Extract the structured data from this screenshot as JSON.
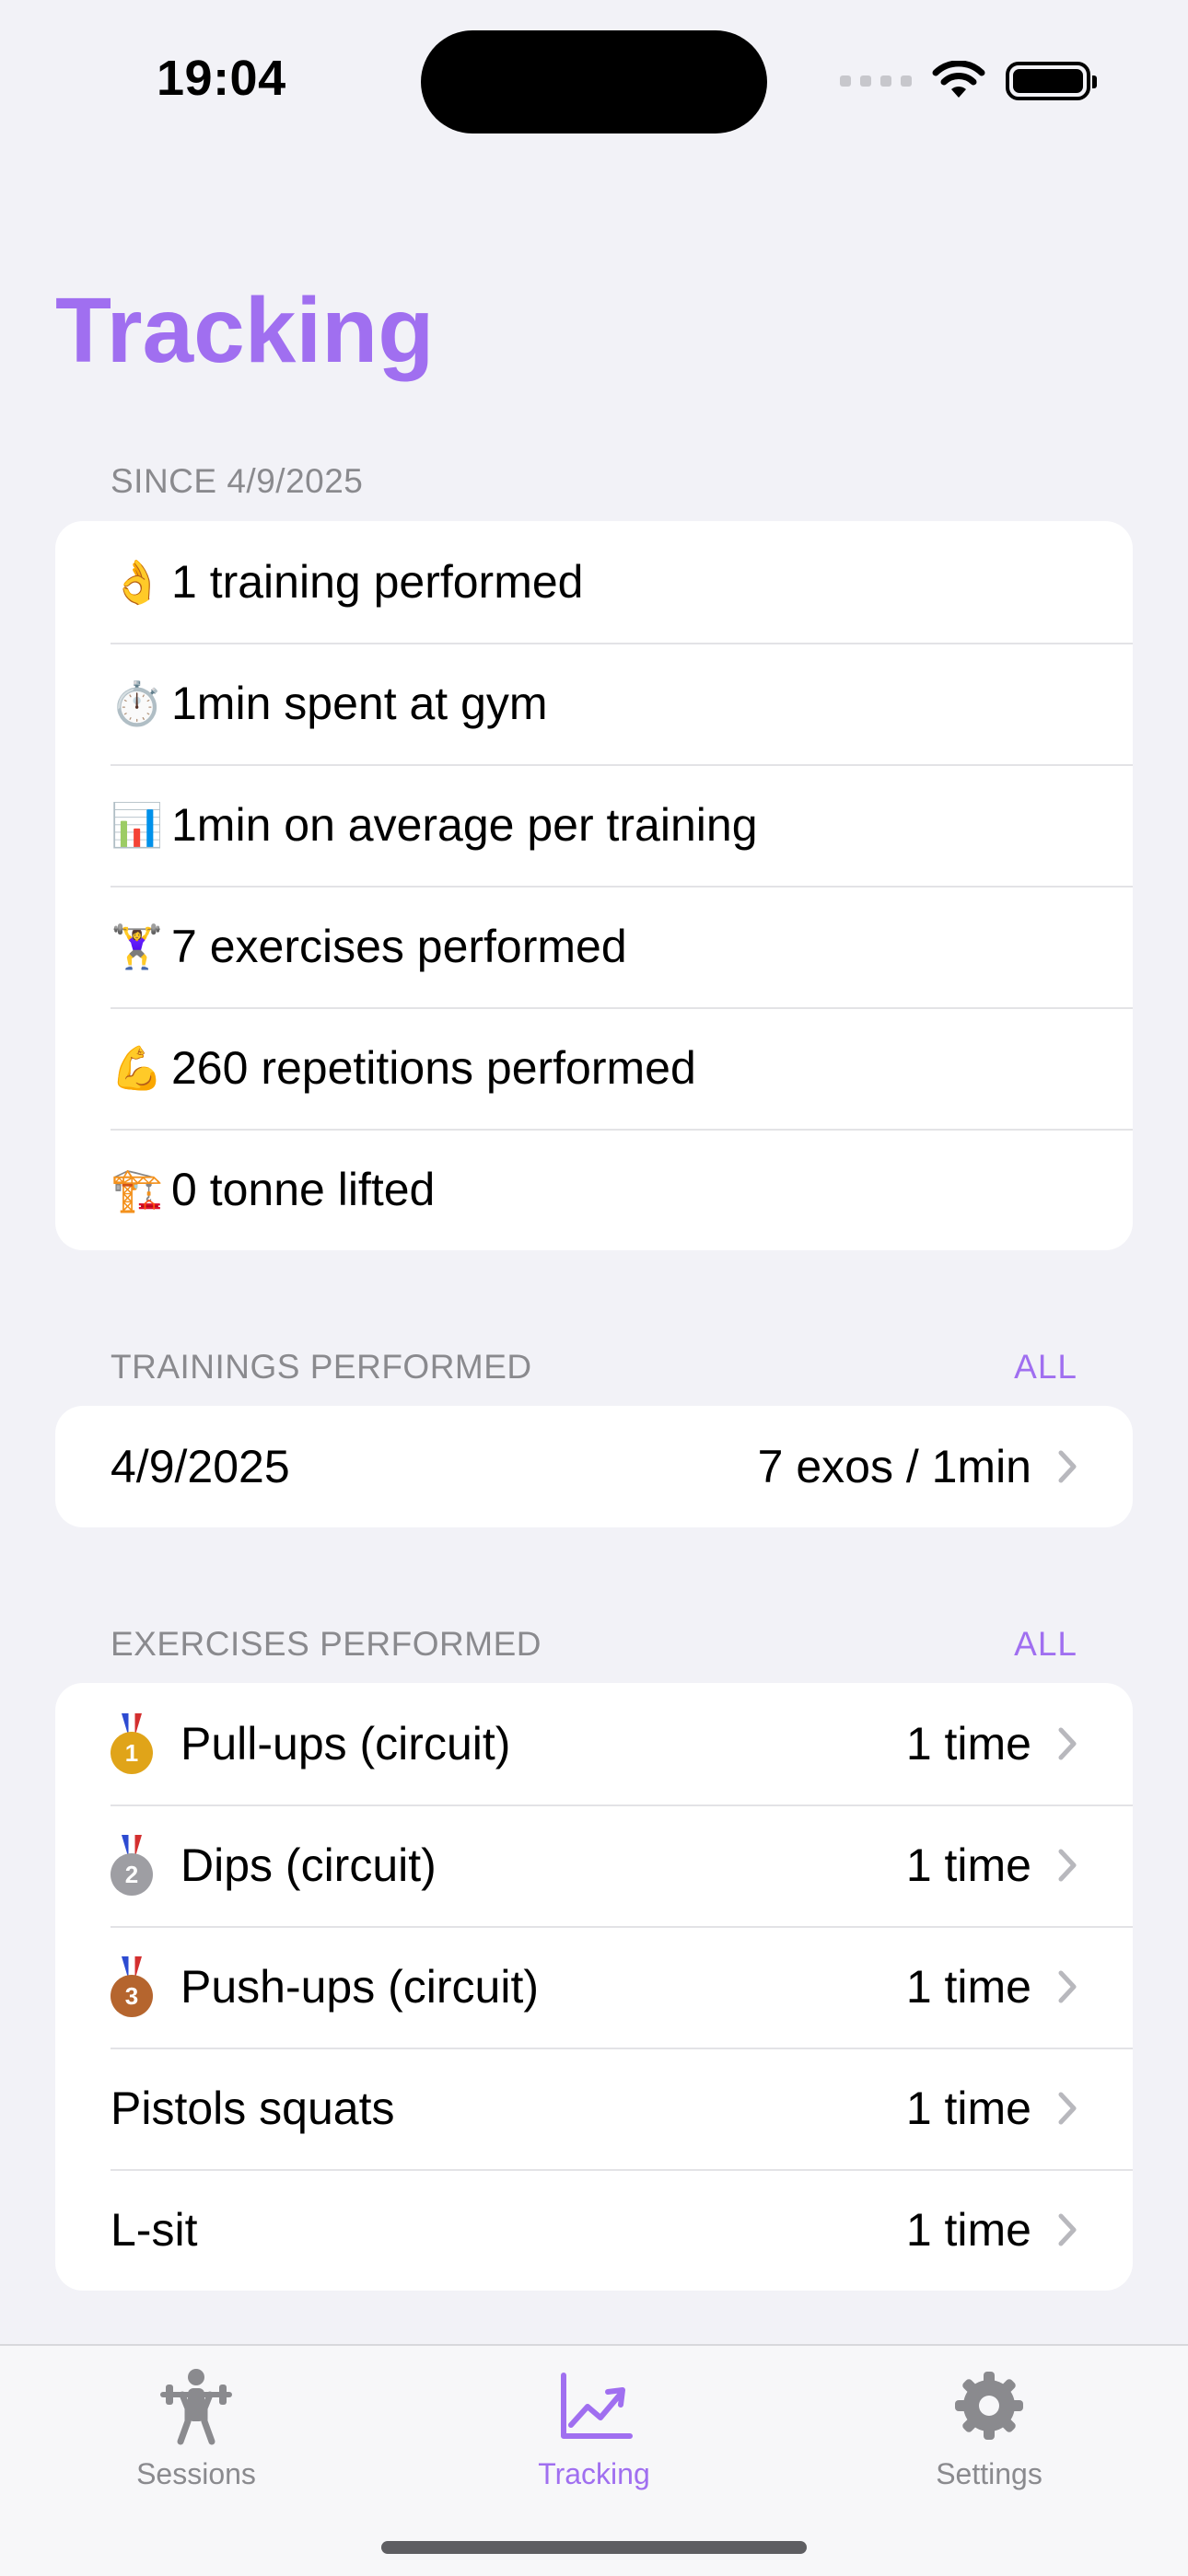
{
  "status_bar": {
    "time": "19:04"
  },
  "page": {
    "title": "Tracking"
  },
  "summary": {
    "header": "SINCE 4/9/2025",
    "rows": [
      {
        "emoji": "👌",
        "icon": "ok-hand-icon",
        "label": "1 training performed"
      },
      {
        "emoji": "⏱️",
        "icon": "stopwatch-icon",
        "label": "1min spent at gym"
      },
      {
        "emoji": "📊",
        "icon": "bar-chart-icon",
        "label": "1min on average per training"
      },
      {
        "emoji": "🏋️‍♀️",
        "icon": "weightlifter-icon",
        "label": "7 exercises performed"
      },
      {
        "emoji": "💪",
        "icon": "flexed-biceps-icon",
        "label": "260 repetitions performed"
      },
      {
        "emoji": "🏗️",
        "icon": "crane-icon",
        "label": "0 tonne lifted"
      }
    ]
  },
  "trainings": {
    "header": "TRAININGS PERFORMED",
    "action": "ALL",
    "rows": [
      {
        "date": "4/9/2025",
        "value": "7 exos / 1min"
      }
    ]
  },
  "exercises": {
    "header": "EXERCISES PERFORMED",
    "action": "ALL",
    "rows": [
      {
        "medal": "1",
        "medal_color": "#e0a419",
        "label": "Pull-ups (circuit)",
        "value": "1 time"
      },
      {
        "medal": "2",
        "medal_color": "#9e9ea3",
        "label": "Dips (circuit)",
        "value": "1 time"
      },
      {
        "medal": "3",
        "medal_color": "#b5652e",
        "label": "Push-ups (circuit)",
        "value": "1 time"
      },
      {
        "label": "Pistols squats",
        "value": "1 time"
      },
      {
        "label": "L-sit",
        "value": "1 time"
      }
    ]
  },
  "tabs": [
    {
      "label": "Sessions",
      "icon": "weightlifting-icon",
      "active": false
    },
    {
      "label": "Tracking",
      "icon": "chart-trend-icon",
      "active": true
    },
    {
      "label": "Settings",
      "icon": "gear-icon",
      "active": false
    }
  ],
  "colors": {
    "accent": "#a06ff0",
    "inactive": "#8a8a8e",
    "background": "#f2f2f7"
  }
}
